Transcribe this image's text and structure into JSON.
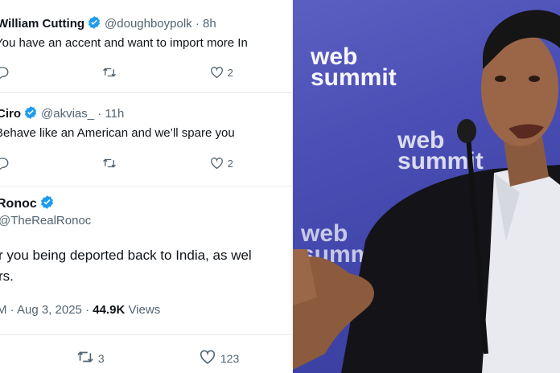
{
  "tweets": [
    {
      "name": "William Cutting",
      "handle": "@doughboypolk",
      "time": "· 8h",
      "text": "You have an accent and want to import more In",
      "likes": "2"
    },
    {
      "name": "Ciro",
      "handle": "@akvias_",
      "time": "· 11h",
      "text": "Behave like an American and we’ll spare you",
      "likes": "2"
    }
  ],
  "main_tweet": {
    "name": "Ronoc",
    "handle": "@TheRealRonoc",
    "line1": "r you being deported back to India, as wel",
    "line2": "rs.",
    "timestamp": "M · Aug 3, 2025 ·",
    "views_count": "44.9K",
    "views_label": "Views",
    "retweets": "3",
    "likes": "123"
  },
  "photo": {
    "banner_text_1": "web",
    "banner_text_2": "summit"
  },
  "colors": {
    "verified": "#1d9bf0",
    "secondary_text": "#536471",
    "backdrop": "#4b4fb5"
  }
}
